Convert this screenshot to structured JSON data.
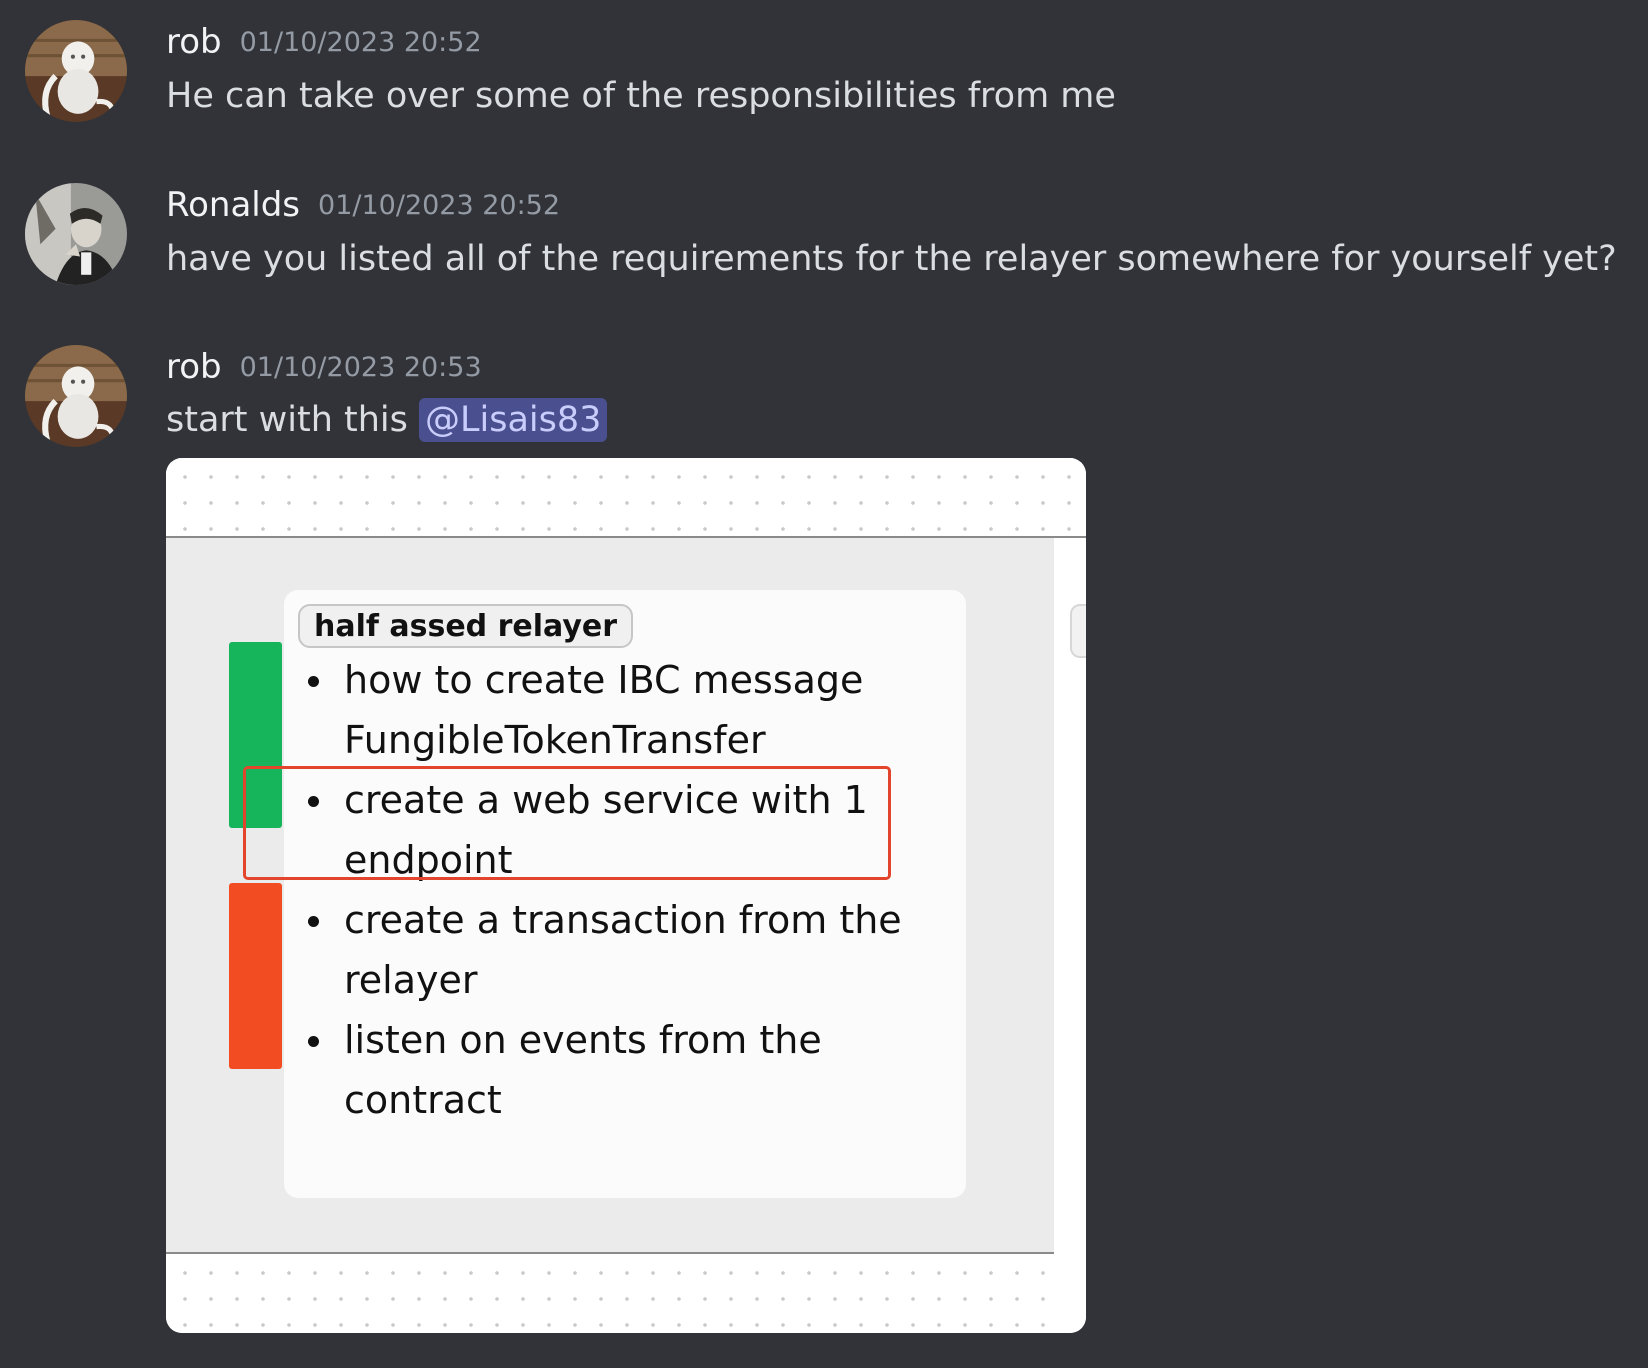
{
  "messages": [
    {
      "username": "rob",
      "timestamp": "01/10/2023 20:52",
      "text": "He can take over some of the responsibilities from me"
    },
    {
      "username": "Ronalds",
      "timestamp": "01/10/2023 20:52",
      "text": "have you listed all of the requirements for the relayer somewhere for yourself yet?"
    },
    {
      "username": "rob",
      "timestamp": "01/10/2023 20:53",
      "text": "start with this ",
      "mention": "@Lisais83"
    }
  ],
  "attachment": {
    "tag": "half assed relayer",
    "items": [
      "how to create IBC message FungibleTokenTransfer",
      "create a web service with 1 endpoint",
      "create a transaction from the relayer",
      "listen on events from the contract"
    ],
    "colors": {
      "green_bar": "#16b55c",
      "orange_bar": "#f24d22",
      "highlight_border": "#e2452c"
    }
  },
  "icons": {
    "rob_avatar": "monkey-lamp-avatar-icon",
    "ronalds_avatar": "portrait-avatar-icon"
  },
  "colors": {
    "background": "#313338",
    "username": "#f2f3f5",
    "timestamp": "#949ba4",
    "text": "#dbdee1",
    "mention_bg": "#4a4f8f",
    "mention_text": "#c9cdfb"
  }
}
